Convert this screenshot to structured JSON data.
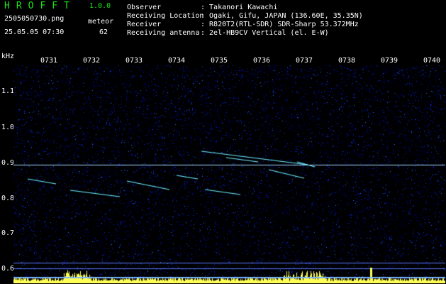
{
  "header": {
    "app_name": "HROFFT",
    "version": "1.0.0",
    "filename": "2505050730.png",
    "meteor_label": "meteor",
    "datetime": "25.05.05 07:30",
    "meteor_count": "62"
  },
  "station_info": [
    {
      "key": "Observer",
      "value": ": Takanori Kawachi"
    },
    {
      "key": "Receiving Location",
      "value": ": Ogaki, Gifu, JAPAN (136.60E, 35.35N)"
    },
    {
      "key": "Receiver",
      "value": ": R820T2(RTL-SDR) SDR-Sharp 53.372MHz"
    },
    {
      "key": "Receiving antenna",
      "value": ": 2el-HB9CV Vertical (el. E-W)"
    }
  ],
  "axis": {
    "unit": "kHz",
    "y_ticks": [
      "1.1",
      "1.0",
      "0.9",
      "0.8",
      "0.7",
      "0.6"
    ],
    "x_ticks": [
      "0731",
      "0732",
      "0733",
      "0734",
      "0735",
      "0736",
      "0737",
      "0738",
      "0739",
      "0740"
    ]
  },
  "colors": {
    "background": "#000000",
    "noise_dark": "#00006e",
    "noise_light": "#2a6bff",
    "trail": "#6ff0ff",
    "carrier": "#ffff55",
    "logo": "#19e619"
  }
}
